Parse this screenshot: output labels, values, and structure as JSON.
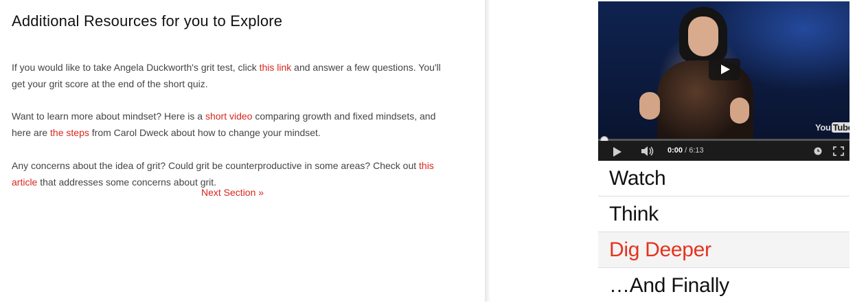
{
  "content": {
    "title": "Additional Resources for you to Explore",
    "p1": {
      "before": "If you would like to take Angela Duckworth's grit test, click ",
      "link": "this link",
      "after": " and answer a few questions. You'll get your grit score at the end of the short quiz."
    },
    "p2": {
      "before": "Want to learn more about mindset? Here is a ",
      "link1": "short video",
      "middle": " comparing growth and fixed mindsets, and here are ",
      "link2": "the steps",
      "after": " from Carol Dweck about how to change your mindset."
    },
    "p3": {
      "before": "Any concerns about the idea of grit? Could grit be counterproductive in some areas? Check out ",
      "link": "this article",
      "after": " that addresses some concerns about grit."
    },
    "next_section": "Next Section »",
    "link_color": "#d7261c"
  },
  "video": {
    "current_time": "0:00",
    "separator": " / ",
    "duration": "6:13",
    "progress_fraction": 0.0,
    "logo_you": "You",
    "logo_tube": "Tube",
    "icons": [
      "play-icon",
      "volume-icon",
      "clock-icon",
      "fullscreen-icon"
    ]
  },
  "nav": {
    "items": [
      {
        "label": "Watch",
        "active": false
      },
      {
        "label": "Think",
        "active": false
      },
      {
        "label": "Dig Deeper",
        "active": true
      },
      {
        "label": "…And Finally",
        "active": false
      }
    ],
    "active_color": "#e6321e"
  }
}
